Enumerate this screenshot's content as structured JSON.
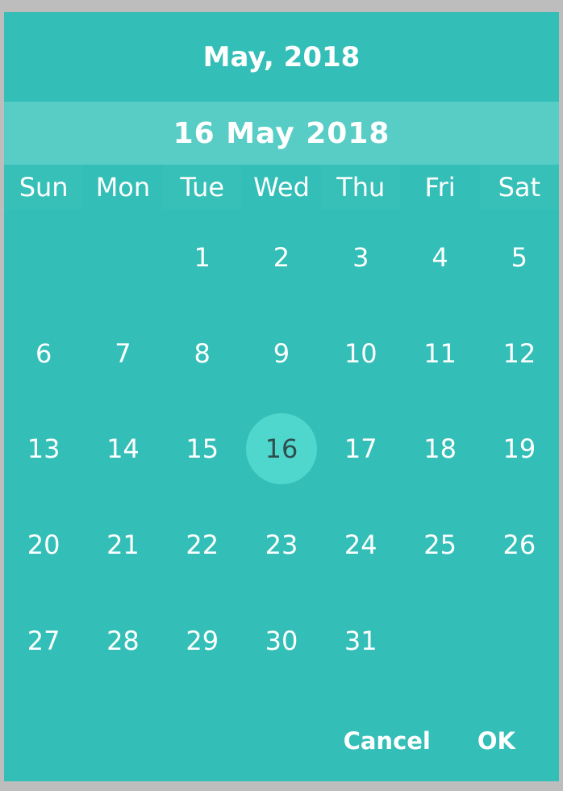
{
  "header": {
    "month_year": "May, 2018",
    "selected_date": "16 May 2018"
  },
  "weekdays": [
    "Sun",
    "Mon",
    "Tue",
    "Wed",
    "Thu",
    "Fri",
    "Sat"
  ],
  "calendar": {
    "leading_blanks": 2,
    "days": [
      1,
      2,
      3,
      4,
      5,
      6,
      7,
      8,
      9,
      10,
      11,
      12,
      13,
      14,
      15,
      16,
      17,
      18,
      19,
      20,
      21,
      22,
      23,
      24,
      25,
      26,
      27,
      28,
      29,
      30,
      31
    ],
    "selected_day": 16
  },
  "actions": {
    "cancel_label": "Cancel",
    "ok_label": "OK"
  },
  "colors": {
    "background": "#33bfb7",
    "date_bar": "#58cdc5",
    "selected_circle": "#4fd7cd",
    "selected_text": "#2f4f4e"
  }
}
